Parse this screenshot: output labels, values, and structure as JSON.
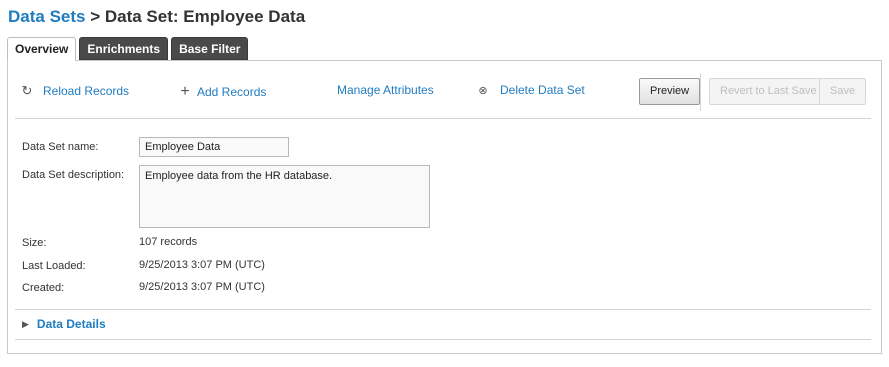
{
  "breadcrumb": {
    "root_link": "Data Sets",
    "separator": " > ",
    "current": "Data Set: Employee Data"
  },
  "tabs": [
    {
      "label": "Overview",
      "active": true
    },
    {
      "label": "Enrichments",
      "active": false
    },
    {
      "label": "Base Filter",
      "active": false
    }
  ],
  "toolbar": {
    "reload_label": "Reload Records",
    "reload_icon": "reload-icon",
    "add_label": "Add Records",
    "add_icon": "plus-icon",
    "manage_label": "Manage Attributes",
    "delete_label": "Delete Data Set",
    "delete_icon": "circle-x-icon",
    "preview_label": "Preview",
    "revert_label": "Revert to Last Save",
    "save_label": "Save"
  },
  "form": {
    "name_label": "Data Set name:",
    "name_value": "Employee Data",
    "description_label": "Data Set description:",
    "description_value": "Employee data from the HR database.",
    "size_label": "Size:",
    "size_value": "107 records",
    "last_loaded_label": "Last Loaded:",
    "last_loaded_value": "9/25/2013 3:07 PM (UTC)",
    "created_label": "Created:",
    "created_value": "9/25/2013 3:07 PM (UTC)"
  },
  "details": {
    "label": "Data Details",
    "expanded": false
  },
  "colors": {
    "link": "#1f7cc0",
    "tab_inactive": "#4a4a4a",
    "disabled_text": "#bfbfbf"
  }
}
